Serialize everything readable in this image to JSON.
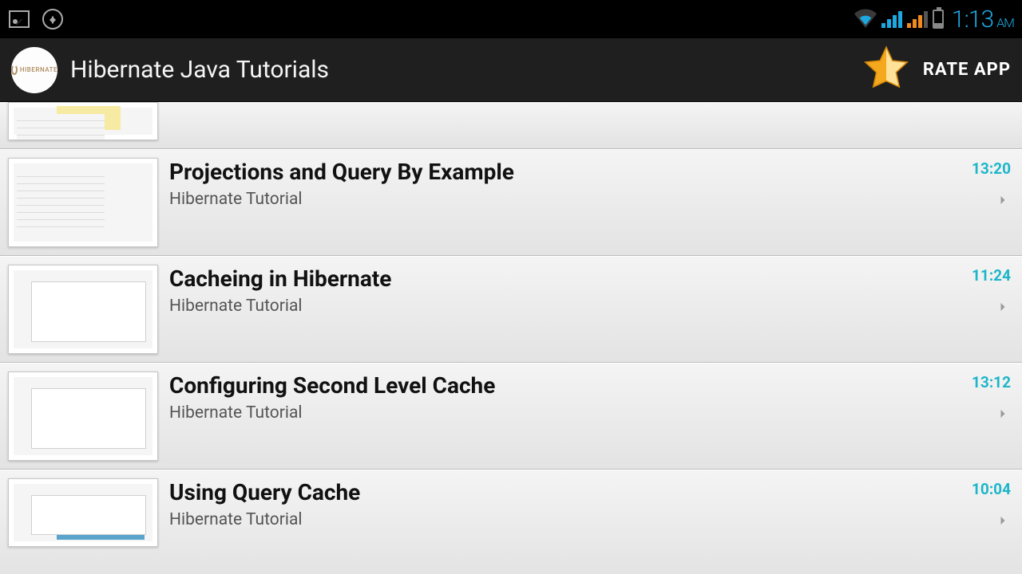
{
  "status_bar": {
    "time": "1:13",
    "ampm": "AM"
  },
  "action_bar": {
    "title": "Hibernate Java Tutorials",
    "app_icon_text": "HIBERNATE",
    "rate_label": "RATE APP"
  },
  "list": [
    {
      "title": "",
      "subtitle": "",
      "duration": ""
    },
    {
      "title": "Projections and Query By Example",
      "subtitle": "Hibernate Tutorial",
      "duration": "13:20"
    },
    {
      "title": "Cacheing in Hibernate",
      "subtitle": "Hibernate Tutorial",
      "duration": "11:24"
    },
    {
      "title": "Configuring Second Level Cache",
      "subtitle": "Hibernate Tutorial",
      "duration": "13:12"
    },
    {
      "title": "Using Query Cache",
      "subtitle": "Hibernate Tutorial",
      "duration": "10:04"
    }
  ]
}
